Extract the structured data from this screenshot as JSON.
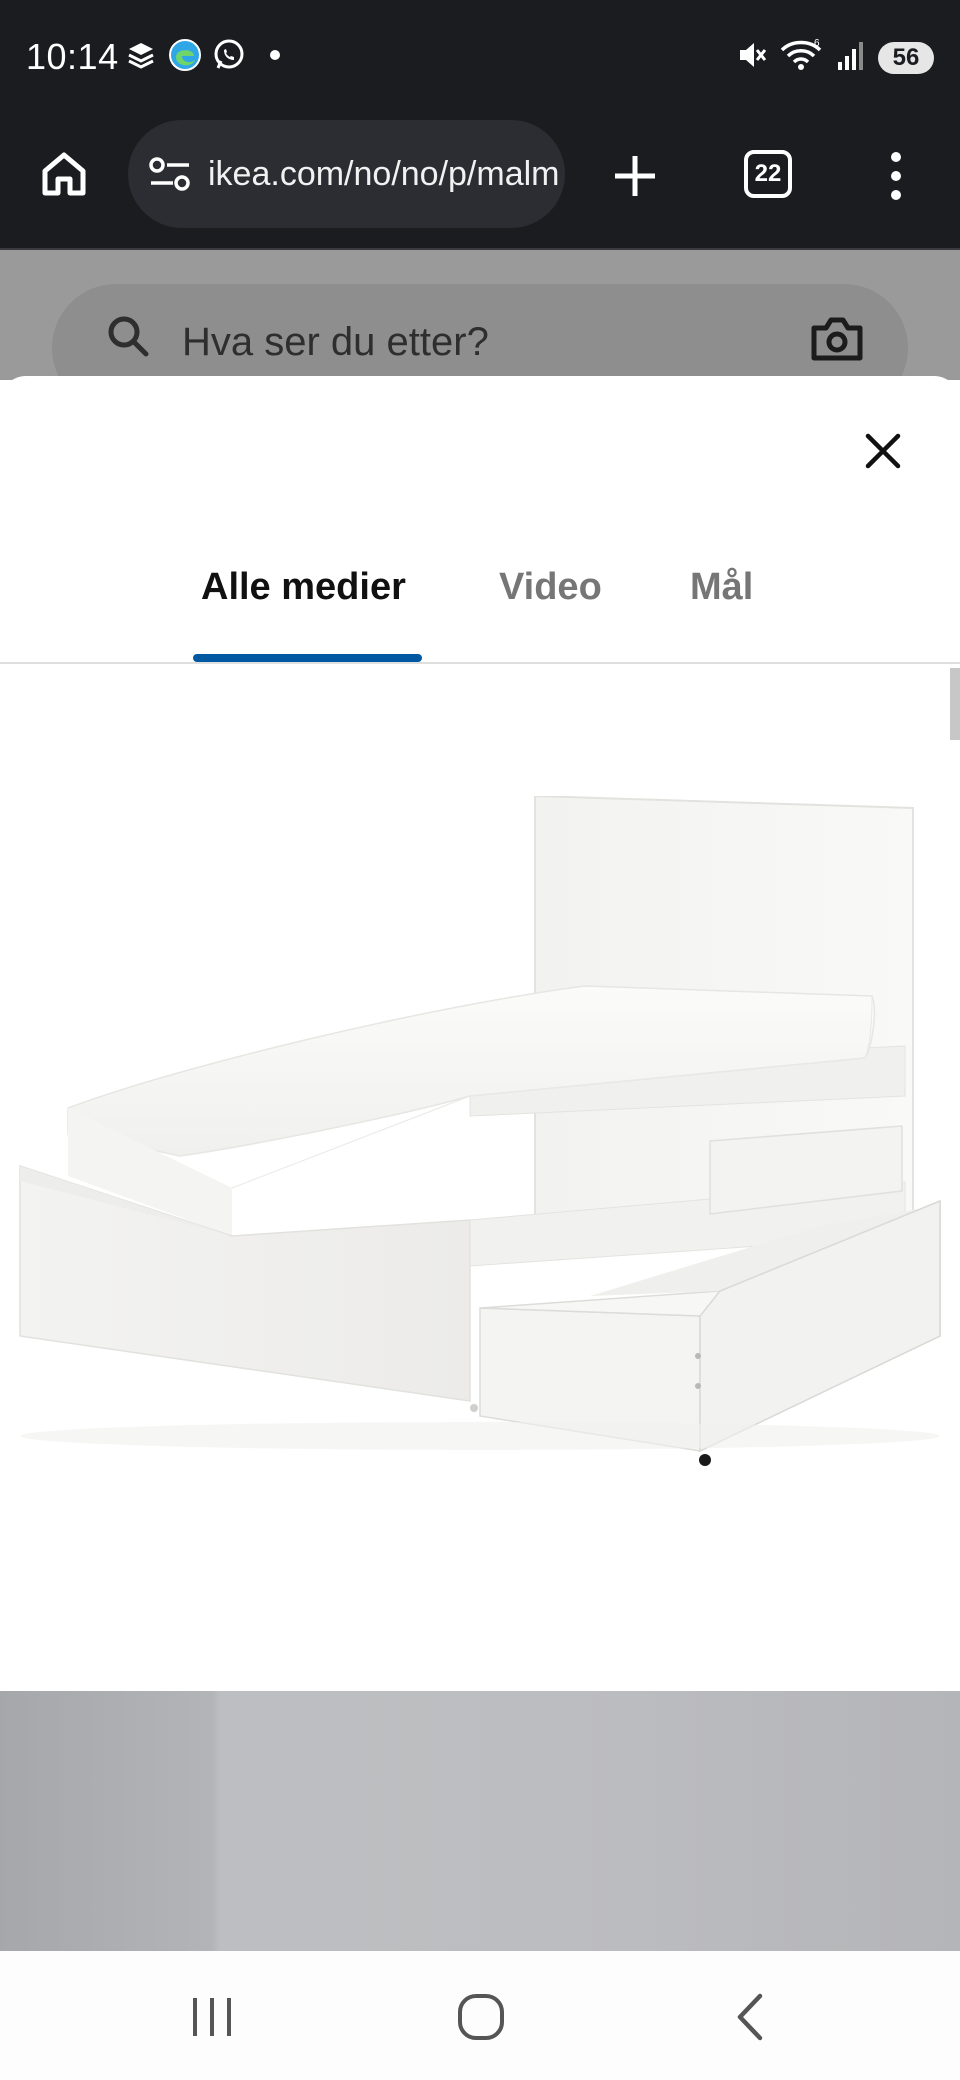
{
  "status_bar": {
    "time": "10:14",
    "battery": "56",
    "icons": [
      "layers-icon",
      "edge-icon",
      "whatsapp-icon",
      "dot-icon",
      "mute-icon",
      "wifi-icon",
      "signal-icon"
    ]
  },
  "browser": {
    "url": "ikea.com/no/no/p/malm",
    "tab_count": "22",
    "icons": [
      "home-icon",
      "tune-icon",
      "plus-icon",
      "tabs-icon",
      "more-icon"
    ]
  },
  "background_page": {
    "search_placeholder": "Hva ser du etter?"
  },
  "media_modal": {
    "tabs": [
      {
        "label": "Alle medier",
        "active": true
      },
      {
        "label": "Video",
        "active": false
      },
      {
        "label": "Mål",
        "active": false
      }
    ],
    "accent_color": "#0058a3"
  },
  "nav_bar": {
    "icons": [
      "recents-icon",
      "home-circle-icon",
      "back-icon"
    ]
  }
}
